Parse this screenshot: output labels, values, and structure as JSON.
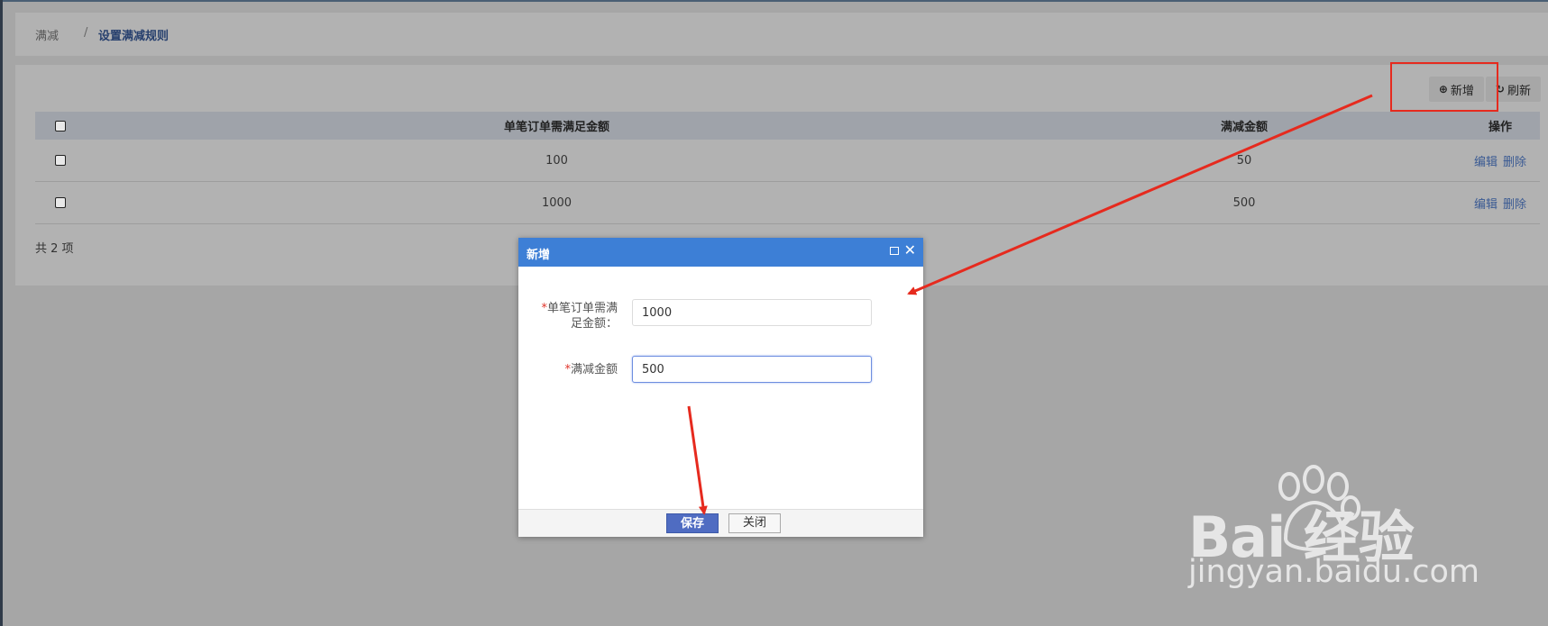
{
  "breadcrumb": {
    "root": "满减",
    "separator": "/",
    "current": "设置满减规则"
  },
  "toolbar": {
    "add_label": "新增",
    "add_icon": "plus-circle-icon",
    "refresh_label": "刷新",
    "refresh_icon": "refresh-icon"
  },
  "table": {
    "headers": [
      "单笔订单需满足金额",
      "满减金额",
      "操作"
    ],
    "rows": [
      {
        "min_amount": "100",
        "discount": "50",
        "edit": "编辑",
        "delete": "删除"
      },
      {
        "min_amount": "1000",
        "discount": "500",
        "edit": "编辑",
        "delete": "删除"
      }
    ],
    "total": "共 2 项"
  },
  "dialog": {
    "title": "新增",
    "fields": [
      {
        "required_mark": "*",
        "label_line1": "单笔订单需满",
        "label_line2": "足金额：",
        "value": "1000"
      },
      {
        "required_mark": "*",
        "label": "满减金额",
        "value": "500"
      }
    ],
    "save_label": "保存",
    "close_label": "关闭"
  },
  "colors": {
    "dialog_header": "#3d7fd6",
    "save_button": "#4f6cc2",
    "annotation": "#e62a1e",
    "link": "#3a5a93"
  },
  "watermark": {
    "brand": "Bai  经验",
    "url": "jingyan.baidu.com"
  }
}
